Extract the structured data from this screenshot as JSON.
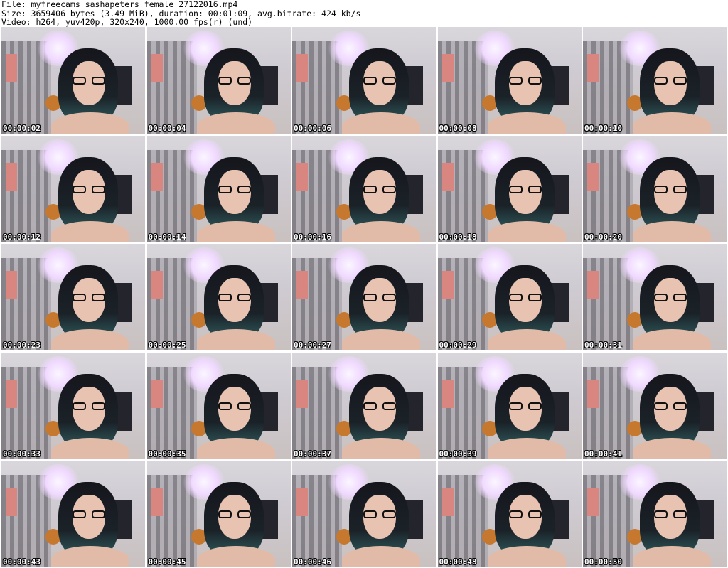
{
  "header": {
    "line1": "File: myfreecams_sashapeters_female_27122016.mp4",
    "line2": "Size: 3659406 bytes (3.49 MiB), duration: 00:01:09, avg.bitrate: 424 kb/s",
    "line3": "Video: h264, yuv420p, 320x240, 1000.00 fps(r) (und)"
  },
  "thumbnails": [
    {
      "timestamp": "00:00:02"
    },
    {
      "timestamp": "00:00:04"
    },
    {
      "timestamp": "00:00:06"
    },
    {
      "timestamp": "00:00:08"
    },
    {
      "timestamp": "00:00:10"
    },
    {
      "timestamp": "00:00:12"
    },
    {
      "timestamp": "00:00:14"
    },
    {
      "timestamp": "00:00:16"
    },
    {
      "timestamp": "00:00:18"
    },
    {
      "timestamp": "00:00:20"
    },
    {
      "timestamp": "00:00:23"
    },
    {
      "timestamp": "00:00:25"
    },
    {
      "timestamp": "00:00:27"
    },
    {
      "timestamp": "00:00:29"
    },
    {
      "timestamp": "00:00:31"
    },
    {
      "timestamp": "00:00:33"
    },
    {
      "timestamp": "00:00:35"
    },
    {
      "timestamp": "00:00:37"
    },
    {
      "timestamp": "00:00:39"
    },
    {
      "timestamp": "00:00:41"
    },
    {
      "timestamp": "00:00:43"
    },
    {
      "timestamp": "00:00:45"
    },
    {
      "timestamp": "00:00:46"
    },
    {
      "timestamp": "00:00:48"
    },
    {
      "timestamp": "00:00:50"
    }
  ]
}
